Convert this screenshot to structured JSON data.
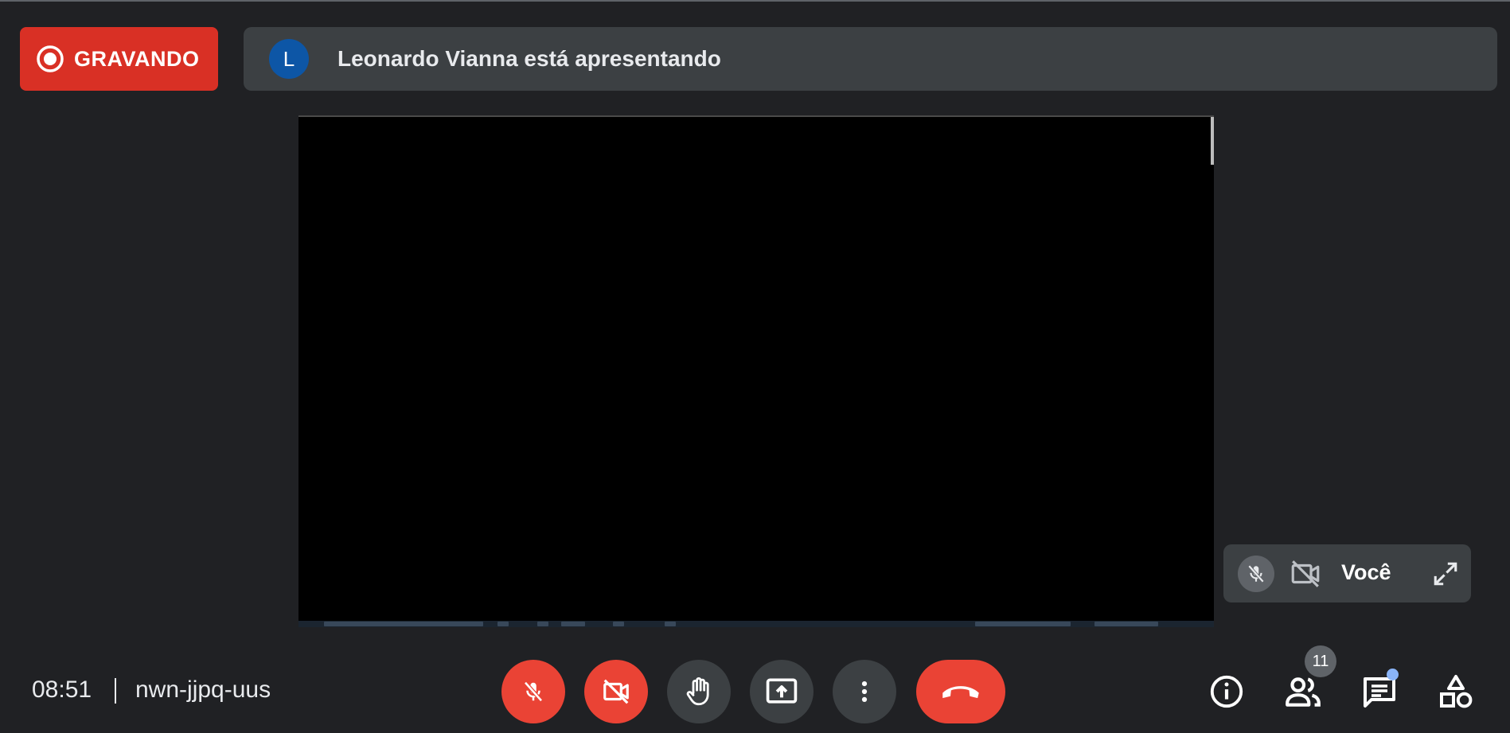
{
  "recording": {
    "label": "GRAVANDO",
    "color": "#d93025",
    "icon": "record-icon"
  },
  "presenter": {
    "avatar_letter": "L",
    "avatar_color": "#0d56a6",
    "message": "Leonardo Vianna está apresentando"
  },
  "self_tile": {
    "name": "Você",
    "mic_icon": "mic-off-icon",
    "cam_icon": "camera-off-icon",
    "expand_icon": "expand-icon"
  },
  "meeting": {
    "time": "08:51",
    "code": "nwn-jjpq-uus"
  },
  "controls": [
    {
      "name": "mic-toggle",
      "icon": "mic-off-icon",
      "state": "off",
      "color": "#ea4335"
    },
    {
      "name": "camera-toggle",
      "icon": "camera-off-icon",
      "state": "off",
      "color": "#ea4335"
    },
    {
      "name": "raise-hand",
      "icon": "hand-icon"
    },
    {
      "name": "present-now",
      "icon": "present-icon"
    },
    {
      "name": "more-options",
      "icon": "more-vert-icon"
    },
    {
      "name": "leave-call",
      "icon": "hangup-icon",
      "color": "#ea4335"
    }
  ],
  "right_controls": {
    "info_icon": "info-icon",
    "people_icon": "people-icon",
    "people_count": "11",
    "chat_icon": "chat-icon",
    "chat_has_unread": true,
    "activities_icon": "activities-icon"
  }
}
